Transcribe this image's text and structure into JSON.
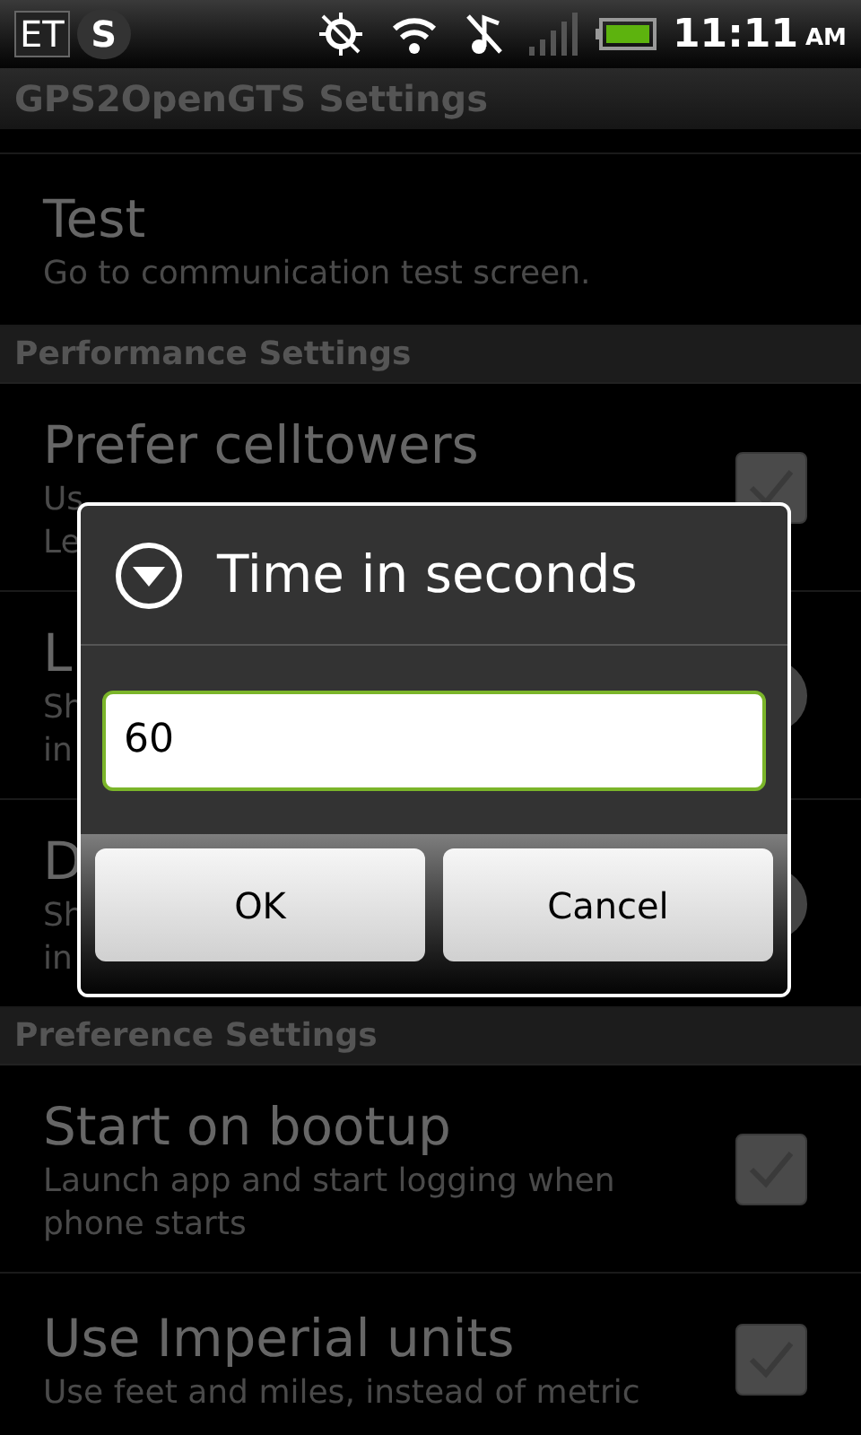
{
  "status_bar": {
    "notifications": [
      "ET",
      "S"
    ],
    "time": "11:11",
    "ampm": "AM"
  },
  "title_bar": {
    "title": "GPS2OpenGTS Settings"
  },
  "list": [
    {
      "kind": "plain",
      "title": "Test",
      "summary": [
        "Go to communication test screen."
      ]
    },
    {
      "kind": "header",
      "title": "Performance Settings"
    },
    {
      "kind": "checkbox",
      "title": "Prefer celltowers",
      "summary": [
        "Us",
        "Le"
      ],
      "checked": true
    },
    {
      "kind": "round",
      "title": "L",
      "summary": [
        "Sh",
        "in"
      ]
    },
    {
      "kind": "round",
      "title": "D",
      "summary": [
        "Sh",
        "in"
      ]
    },
    {
      "kind": "header",
      "title": "Preference Settings"
    },
    {
      "kind": "checkbox",
      "title": "Start on bootup",
      "summary": [
        "Launch app and start logging when",
        "phone starts"
      ],
      "checked": true
    },
    {
      "kind": "checkbox",
      "title": "Use Imperial units",
      "summary": [
        "Use feet and miles, instead of metric"
      ],
      "checked": true
    }
  ],
  "dialog": {
    "title": "Time in seconds",
    "value": "60",
    "buttons": [
      "OK",
      "Cancel"
    ]
  }
}
